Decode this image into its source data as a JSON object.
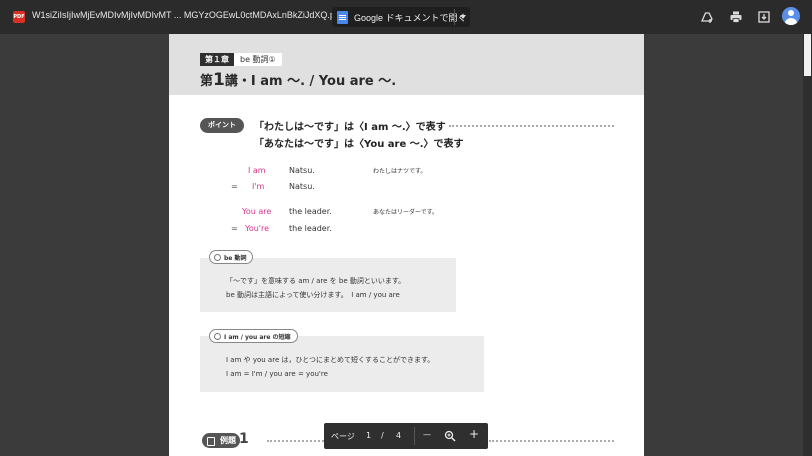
{
  "toolbar": {
    "pdf_badge": "PDF",
    "filename": "W1siZiIsIjIwMjEvMDIvMjIvMDIvMT ... MGYzOGEwL0ctMDAxLnBkZiJdXQ.pdf",
    "open_with_label": "Google ドキュメントで開く",
    "icons": [
      "drive-add-icon",
      "print-icon",
      "download-icon",
      "avatar"
    ]
  },
  "page": {
    "chapter": "第１章",
    "chapter_topic": "be 動詞①",
    "lesson_prefix": "第",
    "lesson_number": "1",
    "lesson_title": "講・I am ～. / You are ～.",
    "point_label": "ポイント",
    "point_line1": "「わたしは～です」は〈I am ～.〉で表す",
    "point_line2": "「あなたは～です」は〈You are ～.〉で表す",
    "examples": [
      {
        "eq": "",
        "subject": "I am",
        "rest": "Natsu.",
        "jp": "わたしはナツです。"
      },
      {
        "eq": "=",
        "subject": "I'm",
        "rest": "Natsu.",
        "jp": ""
      },
      {
        "eq": "",
        "subject": "You are",
        "rest": "the leader.",
        "jp": "あなたはリーダーです。"
      },
      {
        "eq": "=",
        "subject": "You're",
        "rest": "the leader.",
        "jp": ""
      }
    ],
    "box1": {
      "label": "be 動詞",
      "line1": "「～です」を意味する am / are を be 動詞といいます。",
      "line2": "be 動詞は主語によって使い分けます。　I am / you are"
    },
    "box2": {
      "label": "I am / you are の短縮",
      "line1": "I am や you are は，ひとつにまとめて短くすることができます。",
      "line2": "I am = I'm / you are = you're"
    },
    "example_label": "例題",
    "example_number": "1"
  },
  "pager": {
    "page_label": "ページ",
    "current": "1",
    "slash": "/",
    "total": "4",
    "zoom_out": "—",
    "zoom_in": "+"
  }
}
